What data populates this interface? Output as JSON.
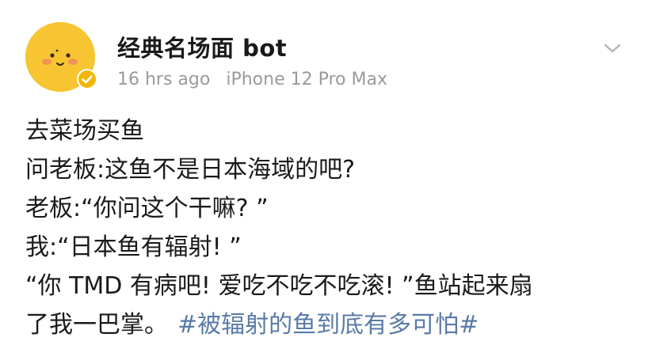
{
  "post": {
    "author": {
      "name": "经典名场面 bot",
      "avatar_color": "#f7c531",
      "verified_badge_color": "#f2b705"
    },
    "meta": {
      "time": "16 hrs ago",
      "device": "iPhone 12 Pro Max"
    },
    "menu_icon": "chevron-down-icon",
    "lines": [
      "去菜场买鱼",
      "问老板:这鱼不是日本海域的吧?",
      "老板:“你问这个干嘛? ”",
      "我:“日本鱼有辐射! ”",
      "“你 TMD 有病吧! 爱吃不吃不吃滚! ”鱼站起来扇",
      "了我一巴掌。"
    ],
    "hashtag": "#被辐射的鱼到底有多可怕#",
    "hashtag_color": "#5a7aa8"
  }
}
